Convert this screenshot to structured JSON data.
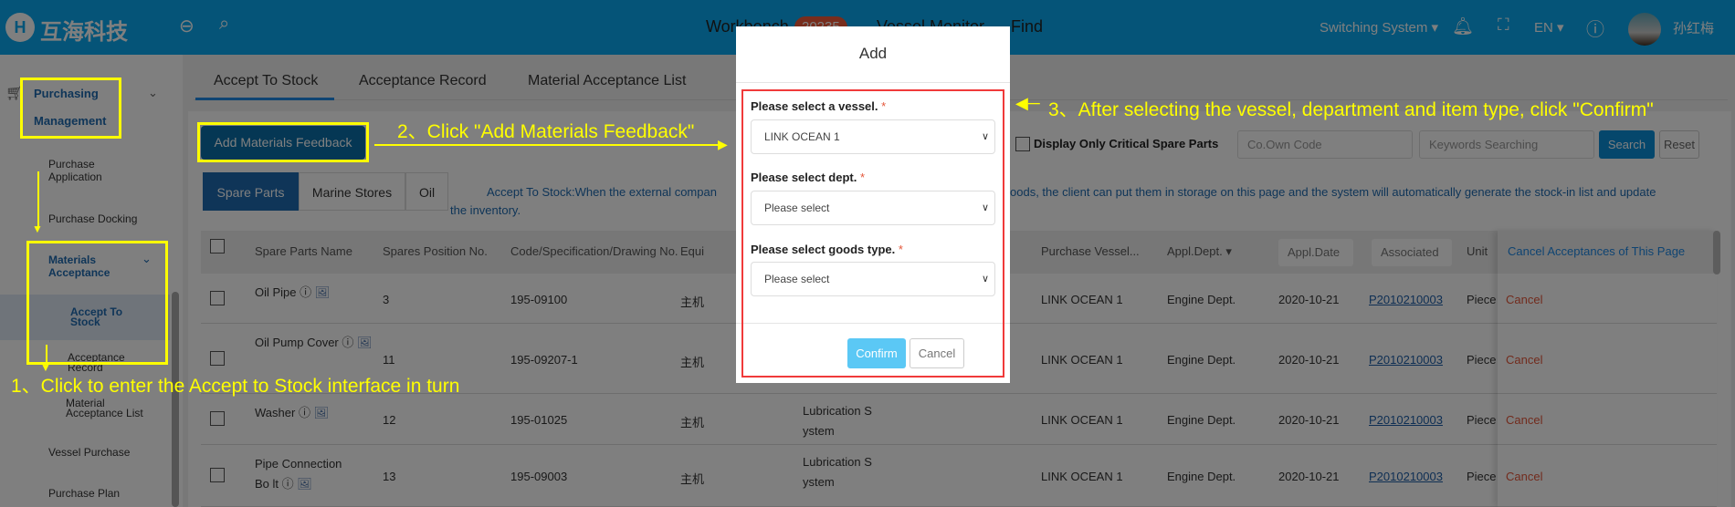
{
  "header": {
    "logo_text": "互海科技",
    "nav": [
      {
        "label": "Workbench",
        "badge": "20235"
      },
      {
        "label": "Vessel Monitor"
      },
      {
        "label": "Find"
      }
    ],
    "switching_system": "Switching System",
    "language": "EN",
    "user_name": "孙红梅",
    "icons": [
      "back-icon",
      "search-icon",
      "bell-icon",
      "fullscreen-icon",
      "help-icon"
    ]
  },
  "sidebar": {
    "group": {
      "line1": "Purchasing",
      "line2": "Management"
    },
    "items": [
      {
        "label": "Purchase Application"
      },
      {
        "label": "Purchase Docking"
      },
      {
        "label": "Materials Acceptance"
      },
      {
        "label": "Accept To Stock",
        "selected": true
      },
      {
        "label": "Acceptance Record"
      },
      {
        "label": "Material Acceptance List"
      },
      {
        "label": "Vessel Purchase"
      },
      {
        "label": "Purchase Plan"
      }
    ]
  },
  "tabs": [
    "Accept To Stock",
    "Acceptance Record",
    "Material Acceptance List"
  ],
  "toolbar": {
    "add_label": "Add Materials Feedback",
    "critical_label": "Display Only Critical Spare Parts",
    "co_code_placeholder": "Co.Own Code",
    "keywords_placeholder": "Keywords Searching",
    "search_label": "Search",
    "reset_label": "Reset"
  },
  "subtabs": [
    "Spare Parts",
    "Marine Stores",
    "Oil"
  ],
  "description": {
    "line1": "Accept To Stock:When the external compan",
    "line1b": "oods, the client can put them in storage on this page and the system will automatically generate the stock-in list and update",
    "line2": "the inventory."
  },
  "table": {
    "headers": {
      "name": "Spare Parts Name",
      "position": "Spares Position No.",
      "code": "Code/Specification/Drawing No.",
      "equip": "Equi",
      "vessel": "Purchase Vessel...",
      "dept": "Appl.Dept.",
      "date": "Appl.Date",
      "assoc": "Associated",
      "unit": "Unit",
      "cancel_all": "Cancel Acceptances of This Page"
    },
    "rows": [
      {
        "name": "Oil Pipe",
        "position": "3",
        "code": "195-09100",
        "equip": "主机",
        "system": "",
        "vessel": "LINK OCEAN 1",
        "dept": "Engine Dept.",
        "date": "2020-10-21",
        "assoc": "P2010210003",
        "unit": "Piece",
        "action": "Cancel"
      },
      {
        "name": "Oil Pump Cover",
        "position": "11",
        "code": "195-09207-1",
        "equip": "主机",
        "system": "",
        "vessel": "LINK OCEAN 1",
        "dept": "Engine Dept.",
        "date": "2020-10-21",
        "assoc": "P2010210003",
        "unit": "Piece",
        "action": "Cancel"
      },
      {
        "name": "Washer",
        "position": "12",
        "code": "195-01025",
        "equip": "主机",
        "system": "Lubrication S ystem",
        "vessel": "LINK OCEAN 1",
        "dept": "Engine Dept.",
        "date": "2020-10-21",
        "assoc": "P2010210003",
        "unit": "Piece",
        "action": "Cancel"
      },
      {
        "name": "Pipe Connection Bo lt",
        "position": "13",
        "code": "195-09003",
        "equip": "主机",
        "system": "Lubrication S ystem",
        "vessel": "LINK OCEAN 1",
        "dept": "Engine Dept.",
        "date": "2020-10-21",
        "assoc": "P2010210003",
        "unit": "Piece",
        "action": "Cancel"
      }
    ]
  },
  "modal": {
    "title": "Add",
    "vessel_label": "Please select a vessel.",
    "vessel_value": "LINK OCEAN 1",
    "dept_label": "Please select dept.",
    "dept_value": "Please select",
    "goods_label": "Please select goods type.",
    "goods_value": "Please select",
    "required": "*",
    "confirm": "Confirm",
    "cancel": "Cancel"
  },
  "annotations": {
    "step1": "1、Click to enter the Accept to Stock interface in turn",
    "step2": "2、Click \"Add Materials Feedback\"",
    "step3": "3、After selecting the vessel, department and item type, click \"Confirm\"",
    "highlight_color": "#ffff00",
    "modal_box_color": "#f03a3a"
  }
}
